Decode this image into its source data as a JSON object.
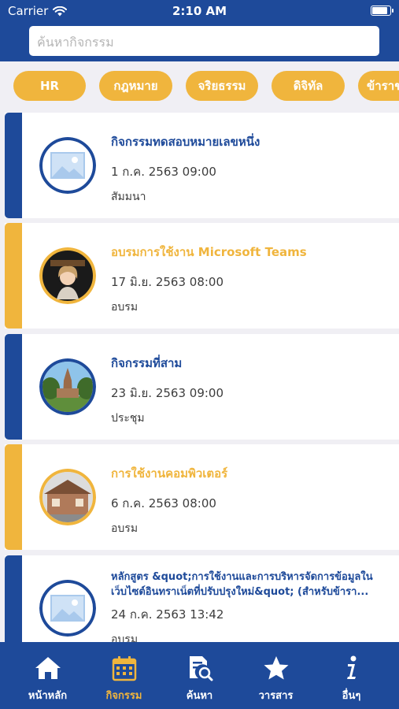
{
  "status": {
    "carrier": "Carrier",
    "time": "2:10 AM"
  },
  "search": {
    "placeholder": "ค้นหากิจกรรม"
  },
  "categories": [
    "HR",
    "กฎหมาย",
    "จริยธรรม",
    "ดิจิทัล",
    "ข้าราช"
  ],
  "activities": [
    {
      "title": "กิจกรรมทดสอบหมายเลขหนึ่ง",
      "date": "1 ก.ค. 2563 09:00",
      "type": "สัมมนา",
      "accent": "#1e4a9a",
      "image": "placeholder-image"
    },
    {
      "title": "อบรมการใช้งาน Microsoft Teams",
      "date": "17 มิ.ย. 2563 08:00",
      "type": "อบรม",
      "accent": "#f0b53d",
      "image": "person-photo"
    },
    {
      "title": "กิจกรรมที่สาม",
      "date": "23 มิ.ย. 2563 09:00",
      "type": "ประชุม",
      "accent": "#1e4a9a",
      "image": "temple-photo"
    },
    {
      "title": "การใช้งานคอมพิวเตอร์",
      "date": "6 ก.ค. 2563 08:00",
      "type": "อบรม",
      "accent": "#f0b53d",
      "image": "house-photo"
    },
    {
      "title": "หลักสูตร &quot;การใช้งานและการบริหารจัดการข้อมูลในเว็บไซต์อินทราเน็ตที่ปรับปรุงใหม่&quot; (สำหรับข้ารา...",
      "date": "24 ก.ค. 2563 13:42",
      "type": "อบรม",
      "accent": "#1e4a9a",
      "image": "placeholder-image"
    }
  ],
  "tabs": [
    {
      "label": "หน้าหลัก",
      "icon": "home-icon",
      "active": false
    },
    {
      "label": "กิจกรรม",
      "icon": "calendar-icon",
      "active": true
    },
    {
      "label": "ค้นหา",
      "icon": "document-search-icon",
      "active": false
    },
    {
      "label": "วารสาร",
      "icon": "star-icon",
      "active": false
    },
    {
      "label": "อื่นๆ",
      "icon": "info-icon",
      "active": false
    }
  ],
  "colors": {
    "primary": "#1e4a9a",
    "accent": "#f0b53d",
    "background": "#f0eff4"
  }
}
